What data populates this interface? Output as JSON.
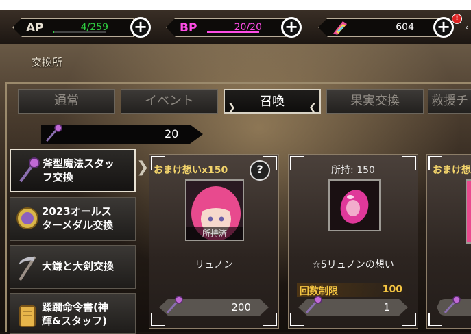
{
  "resources": {
    "ap": {
      "label": "AP",
      "value": "4/259",
      "fill": 0.015,
      "color": "#2ecc40"
    },
    "bp": {
      "label": "BP",
      "value": "20/20",
      "fill": 1.0,
      "color": "#ff4de6"
    },
    "gem": {
      "value": "604",
      "icon": "crystal-icon"
    },
    "alert": "!"
  },
  "page": {
    "title": "交換所"
  },
  "tabs": [
    {
      "label": "通常"
    },
    {
      "label": "イベント"
    },
    {
      "label": "召喚",
      "active": true
    },
    {
      "label": "果実交換"
    },
    {
      "label": "救援チ"
    }
  ],
  "currency": {
    "value": "20",
    "icon": "wand-icon"
  },
  "categories": [
    {
      "label": "斧型魔法スタッフ交換",
      "line1": "斧型魔法スタッ",
      "line2": "フ交換",
      "icon": "wand-icon",
      "active": true
    },
    {
      "label": "2023オールスターメダル交換",
      "line1": "2023オールス",
      "line2": "ターメダル交換",
      "icon": "medal-icon"
    },
    {
      "label": "大鎌と大剣交換",
      "line1": "大鎌と大剣交換",
      "line2": "",
      "icon": "scythe-icon"
    },
    {
      "label": "蹂躙命令書(神輝&スタッフ)",
      "line1": "蹂躙命令書(神",
      "line2": "輝&スタッフ)",
      "icon": "scroll-icon"
    }
  ],
  "cards": [
    {
      "header": "おまけ想いx150",
      "owned_badge": "所持済",
      "name": "リュノン",
      "price": "200",
      "help": "?"
    },
    {
      "header": "所持: 150",
      "name": "☆5リュノンの想い",
      "limit_label": "回数制限",
      "limit_value": "100",
      "price": "1"
    },
    {
      "header": "おまけ想"
    }
  ]
}
